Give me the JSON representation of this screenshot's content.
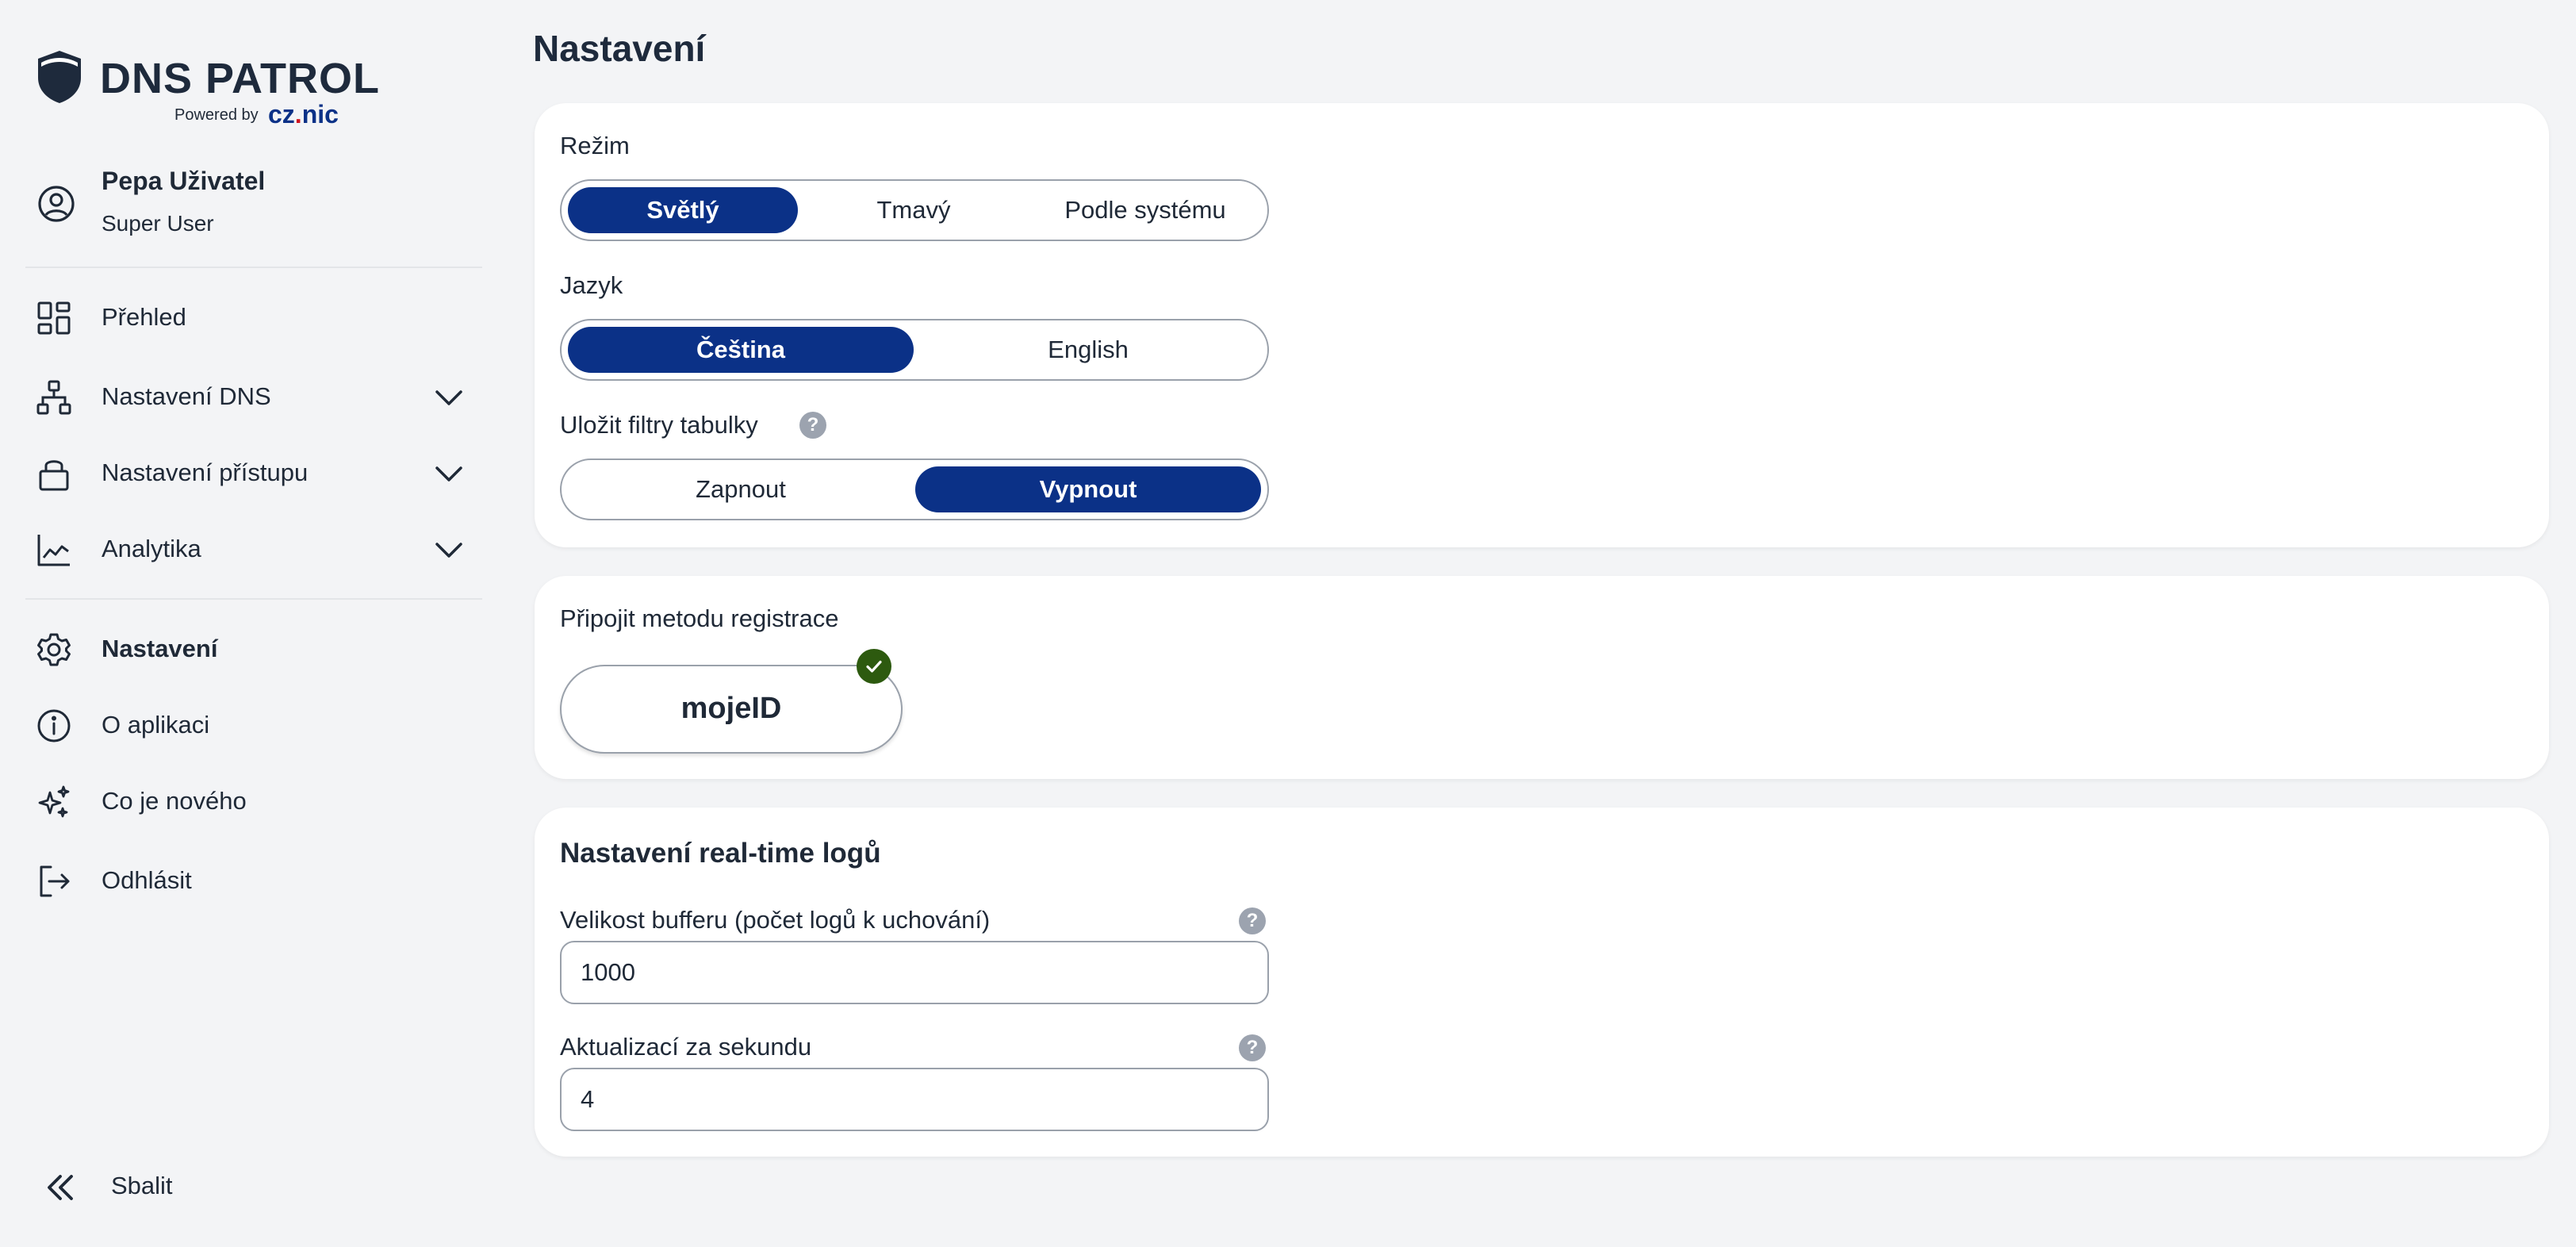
{
  "brand": {
    "title": "DNS PATROL",
    "powered_by": "Powered by",
    "partner_prefix": "cz",
    "partner_suffix": "nic",
    "partner_color": "#0b3187",
    "partner_dot_color": "#d0121f"
  },
  "user": {
    "name": "Pepa Uživatel",
    "role": "Super User",
    "icon": "user-circle-icon"
  },
  "sidebar": {
    "items": [
      {
        "label": "Přehled",
        "icon": "dashboard-icon",
        "expandable": false,
        "active": false
      },
      {
        "label": "Nastavení DNS",
        "icon": "network-icon",
        "expandable": true,
        "active": false
      },
      {
        "label": "Nastavení přístupu",
        "icon": "lock-icon",
        "expandable": true,
        "active": false
      },
      {
        "label": "Analytika",
        "icon": "chart-line-icon",
        "expandable": true,
        "active": false
      },
      {
        "label": "Nastavení",
        "icon": "gear-icon",
        "expandable": false,
        "active": true
      },
      {
        "label": "O aplikaci",
        "icon": "info-icon",
        "expandable": false,
        "active": false
      },
      {
        "label": "Co je nového",
        "icon": "sparkles-icon",
        "expandable": false,
        "active": false
      },
      {
        "label": "Odhlásit",
        "icon": "logout-icon",
        "expandable": false,
        "active": false
      }
    ],
    "collapse_label": "Sbalit"
  },
  "page": {
    "title": "Nastavení"
  },
  "preferences": {
    "mode": {
      "label": "Režim",
      "options": [
        "Světlý",
        "Tmavý",
        "Podle systému"
      ],
      "selected": "Světlý"
    },
    "language": {
      "label": "Jazyk",
      "options": [
        "Čeština",
        "English"
      ],
      "selected": "Čeština"
    },
    "save_filters": {
      "label": "Uložit filtry tabulky",
      "help": "?",
      "options": [
        "Zapnout",
        "Vypnout"
      ],
      "selected": "Vypnout"
    }
  },
  "registration": {
    "heading": "Připojit metodu registrace",
    "method_label": "mojeID",
    "connected": true
  },
  "realtime_logs": {
    "heading": "Nastavení real-time logů",
    "buffer_label": "Velikost bufferu (počet logů k uchování)",
    "buffer_value": "1000",
    "updates_label": "Aktualizací za sekundu",
    "updates_value": "4",
    "help": "?"
  },
  "colors": {
    "accent": "#0b3187",
    "background": "#f3f4f6",
    "card": "#ffffff",
    "success": "#2d5a0f",
    "help_badge": "#9ca3af"
  }
}
